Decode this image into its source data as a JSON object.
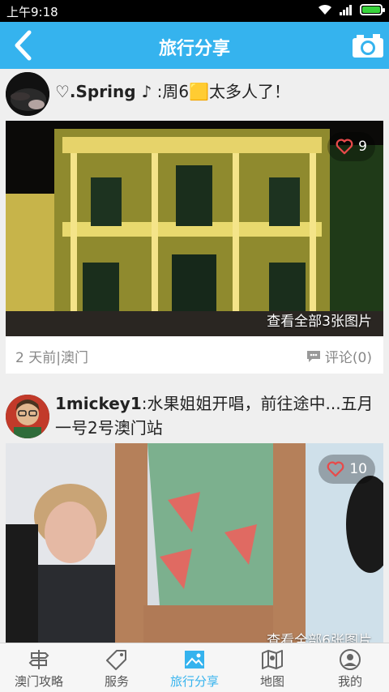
{
  "status_bar": {
    "time": "上午9:18",
    "icons": [
      "wifi-icon",
      "signal-icon",
      "battery-icon"
    ],
    "battery_color": "#39d33c"
  },
  "header": {
    "title": "旅行分享",
    "back_icon": "back-arrow-icon",
    "camera_icon": "camera-icon",
    "color": "#35b3ee"
  },
  "posts": [
    {
      "user": "♡.Spring ♪",
      "text": ":周6🟨太多人了！",
      "likes": "9",
      "view_all": "查看全部3张图片",
      "meta": "2 天前|澳门",
      "comments": "评论(0)"
    },
    {
      "user": "1mickey1",
      "text": ":水果姐姐开唱，前往途中...五月一号2号澳门站",
      "likes": "10",
      "view_all": "查看全部6张图片"
    }
  ],
  "tabs": [
    {
      "label": "澳门攻略",
      "icon": "signpost-icon"
    },
    {
      "label": "服务",
      "icon": "tag-icon"
    },
    {
      "label": "旅行分享",
      "icon": "photo-icon",
      "active": true
    },
    {
      "label": "地图",
      "icon": "map-icon"
    },
    {
      "label": "我的",
      "icon": "user-icon"
    }
  ]
}
